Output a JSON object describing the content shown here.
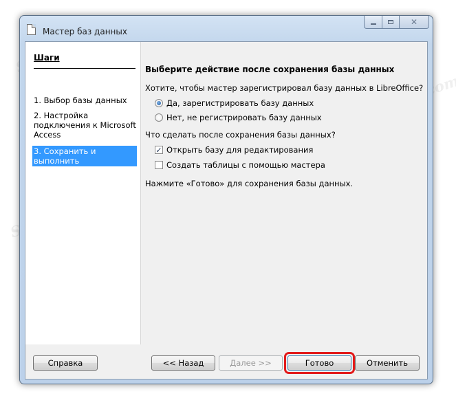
{
  "window": {
    "title": "Мастер баз данных"
  },
  "sidebar": {
    "title": "Шаги",
    "steps": [
      "1. Выбор базы данных",
      "2. Настройка подключения к Microsoft Access",
      "3. Сохранить и выполнить"
    ],
    "active_step": 3
  },
  "main": {
    "heading": "Выберите действие после сохранения базы данных",
    "register_question": "Хотите, чтобы мастер зарегистрировал базу данных в LibreOffice?",
    "register_options": [
      {
        "label": "Да, зарегистрировать базу данных",
        "selected": true
      },
      {
        "label": "Нет, не регистрировать базу данных",
        "selected": false
      }
    ],
    "after_save_question": "Что сделать после сохранения базы данных?",
    "after_save_options": [
      {
        "label": "Открыть базу для редактирования",
        "checked": true
      },
      {
        "label": "Создать таблицы с помощью мастера",
        "checked": false
      }
    ],
    "finish_note": "Нажмите «Готово» для сохранения базы данных."
  },
  "buttons": {
    "help": "Справка",
    "back": "<< Назад",
    "next": "Далее >>",
    "finish": "Готово",
    "cancel": "Отменить"
  },
  "watermark": "Soringpcrepair.com",
  "colors": {
    "selection": "#3399ff",
    "highlight_ring": "#e21b1b"
  }
}
